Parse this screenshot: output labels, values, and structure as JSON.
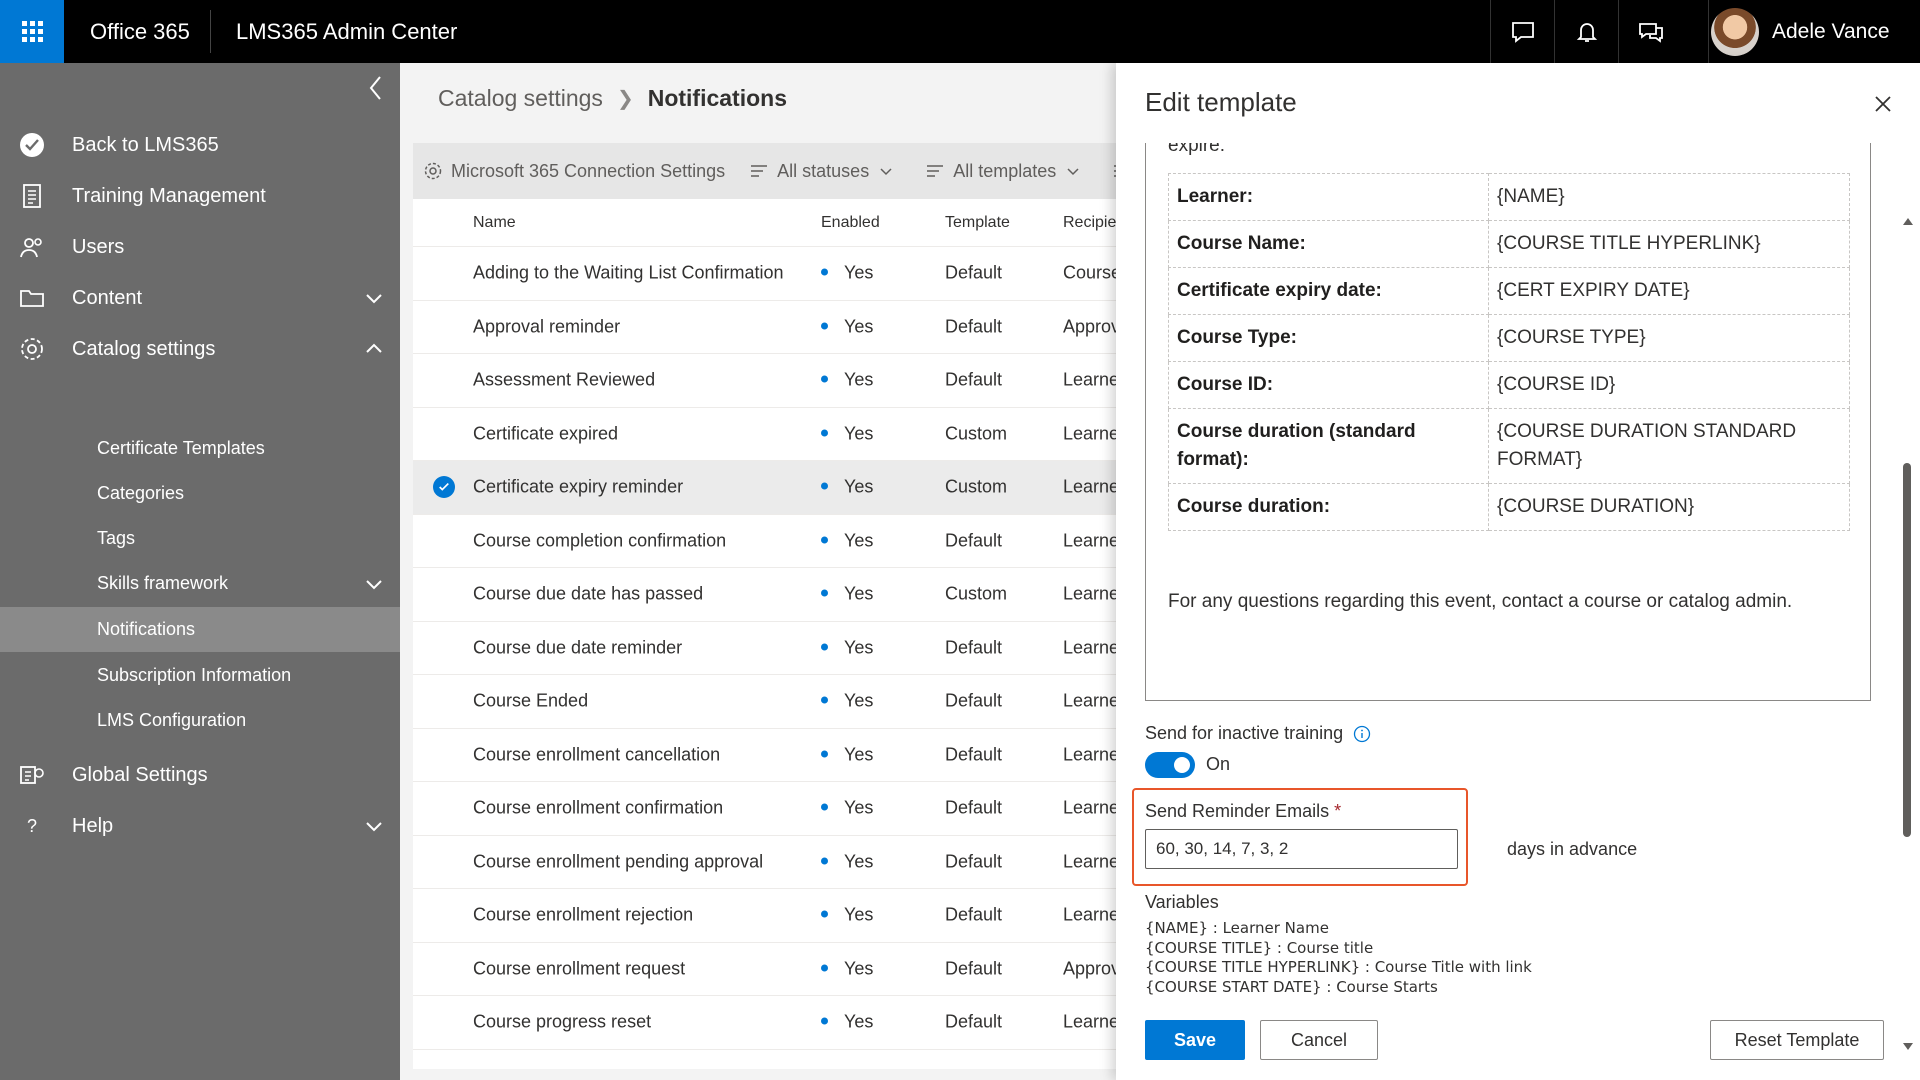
{
  "topbar": {
    "brand": "Office 365",
    "app_title": "LMS365 Admin Center",
    "user_name": "Adele Vance"
  },
  "leftnav": {
    "items": [
      {
        "label": "Back to LMS365",
        "icon": "check-circle-icon"
      },
      {
        "label": "Training Management",
        "icon": "document-icon"
      },
      {
        "label": "Users",
        "icon": "users-icon"
      },
      {
        "label": "Content",
        "icon": "folder-icon",
        "expand": "down"
      },
      {
        "label": "Catalog settings",
        "icon": "gear-icon",
        "expand": "up"
      }
    ],
    "catalog_subitems": [
      {
        "label": "Certificate Templates"
      },
      {
        "label": "Categories"
      },
      {
        "label": "Tags"
      },
      {
        "label": "Skills framework",
        "expand": "down"
      },
      {
        "label": "Notifications",
        "active": true
      },
      {
        "label": "Subscription Information"
      },
      {
        "label": "LMS Configuration"
      }
    ],
    "bottom_items": [
      {
        "label": "Global Settings",
        "icon": "global-settings-icon"
      },
      {
        "label": "Help",
        "icon": "question-icon",
        "expand": "down"
      }
    ]
  },
  "breadcrumb": {
    "parent": "Catalog settings",
    "current": "Notifications"
  },
  "toolbar": {
    "connection": "Microsoft 365 Connection Settings",
    "status_filter": "All statuses",
    "template_filter": "All templates"
  },
  "table": {
    "headers": {
      "name": "Name",
      "enabled": "Enabled",
      "template": "Template",
      "recipient": "Recipie"
    },
    "rows": [
      {
        "name": "Adding to the Waiting List Confirmation",
        "enabled": "Yes",
        "template": "Default",
        "recipient": "Course"
      },
      {
        "name": "Approval reminder",
        "enabled": "Yes",
        "template": "Default",
        "recipient": "Approv"
      },
      {
        "name": "Assessment Reviewed",
        "enabled": "Yes",
        "template": "Default",
        "recipient": "Learne"
      },
      {
        "name": "Certificate expired",
        "enabled": "Yes",
        "template": "Custom",
        "recipient": "Learne"
      },
      {
        "name": "Certificate expiry reminder",
        "enabled": "Yes",
        "template": "Custom",
        "recipient": "Learne",
        "selected": true
      },
      {
        "name": "Course completion confirmation",
        "enabled": "Yes",
        "template": "Default",
        "recipient": "Learne"
      },
      {
        "name": "Course due date has passed",
        "enabled": "Yes",
        "template": "Custom",
        "recipient": "Learne"
      },
      {
        "name": "Course due date reminder",
        "enabled": "Yes",
        "template": "Default",
        "recipient": "Learne"
      },
      {
        "name": "Course Ended",
        "enabled": "Yes",
        "template": "Default",
        "recipient": "Learne"
      },
      {
        "name": "Course enrollment cancellation",
        "enabled": "Yes",
        "template": "Default",
        "recipient": "Learne"
      },
      {
        "name": "Course enrollment confirmation",
        "enabled": "Yes",
        "template": "Default",
        "recipient": "Learne"
      },
      {
        "name": "Course enrollment pending approval",
        "enabled": "Yes",
        "template": "Default",
        "recipient": "Learne"
      },
      {
        "name": "Course enrollment rejection",
        "enabled": "Yes",
        "template": "Default",
        "recipient": "Learne"
      },
      {
        "name": "Course enrollment request",
        "enabled": "Yes",
        "template": "Default",
        "recipient": "Approv"
      },
      {
        "name": "Course progress reset",
        "enabled": "Yes",
        "template": "Default",
        "recipient": "Learne"
      }
    ]
  },
  "panel": {
    "title": "Edit template",
    "editor": {
      "fragment_top": "expire:",
      "rows": [
        {
          "key": "Learner:",
          "value": "{NAME}"
        },
        {
          "key": "Course Name:",
          "value": "{COURSE TITLE HYPERLINK}"
        },
        {
          "key": "Certificate expiry date:",
          "value": "{CERT EXPIRY DATE}"
        },
        {
          "key": "Course Type:",
          "value": "{COURSE TYPE}"
        },
        {
          "key": "Course ID:",
          "value": "{COURSE ID}"
        },
        {
          "key": "Course duration (standard format):",
          "value": "{COURSE DURATION STANDARD FORMAT}"
        },
        {
          "key": "Course duration:",
          "value": "{COURSE DURATION}"
        }
      ],
      "footer": "For any questions regarding this event, contact a course or catalog admin."
    },
    "inactive_label": "Send for inactive training",
    "toggle_state": "On",
    "reminder_label": "Send Reminder Emails",
    "reminder_required": "*",
    "reminder_value": "60, 30, 14, 7, 3, 2",
    "days_label": "days in advance",
    "variables_title": "Variables",
    "variables": [
      "{NAME} : Learner Name",
      "{COURSE TITLE} : Course title",
      "{COURSE TITLE HYPERLINK} : Course Title with link",
      "{COURSE START DATE} : Course Starts"
    ],
    "save": "Save",
    "cancel": "Cancel",
    "reset": "Reset Template"
  },
  "colors": {
    "accent": "#0078d4",
    "nav_bg": "#6b6b6b",
    "highlight": "#e8562a"
  }
}
